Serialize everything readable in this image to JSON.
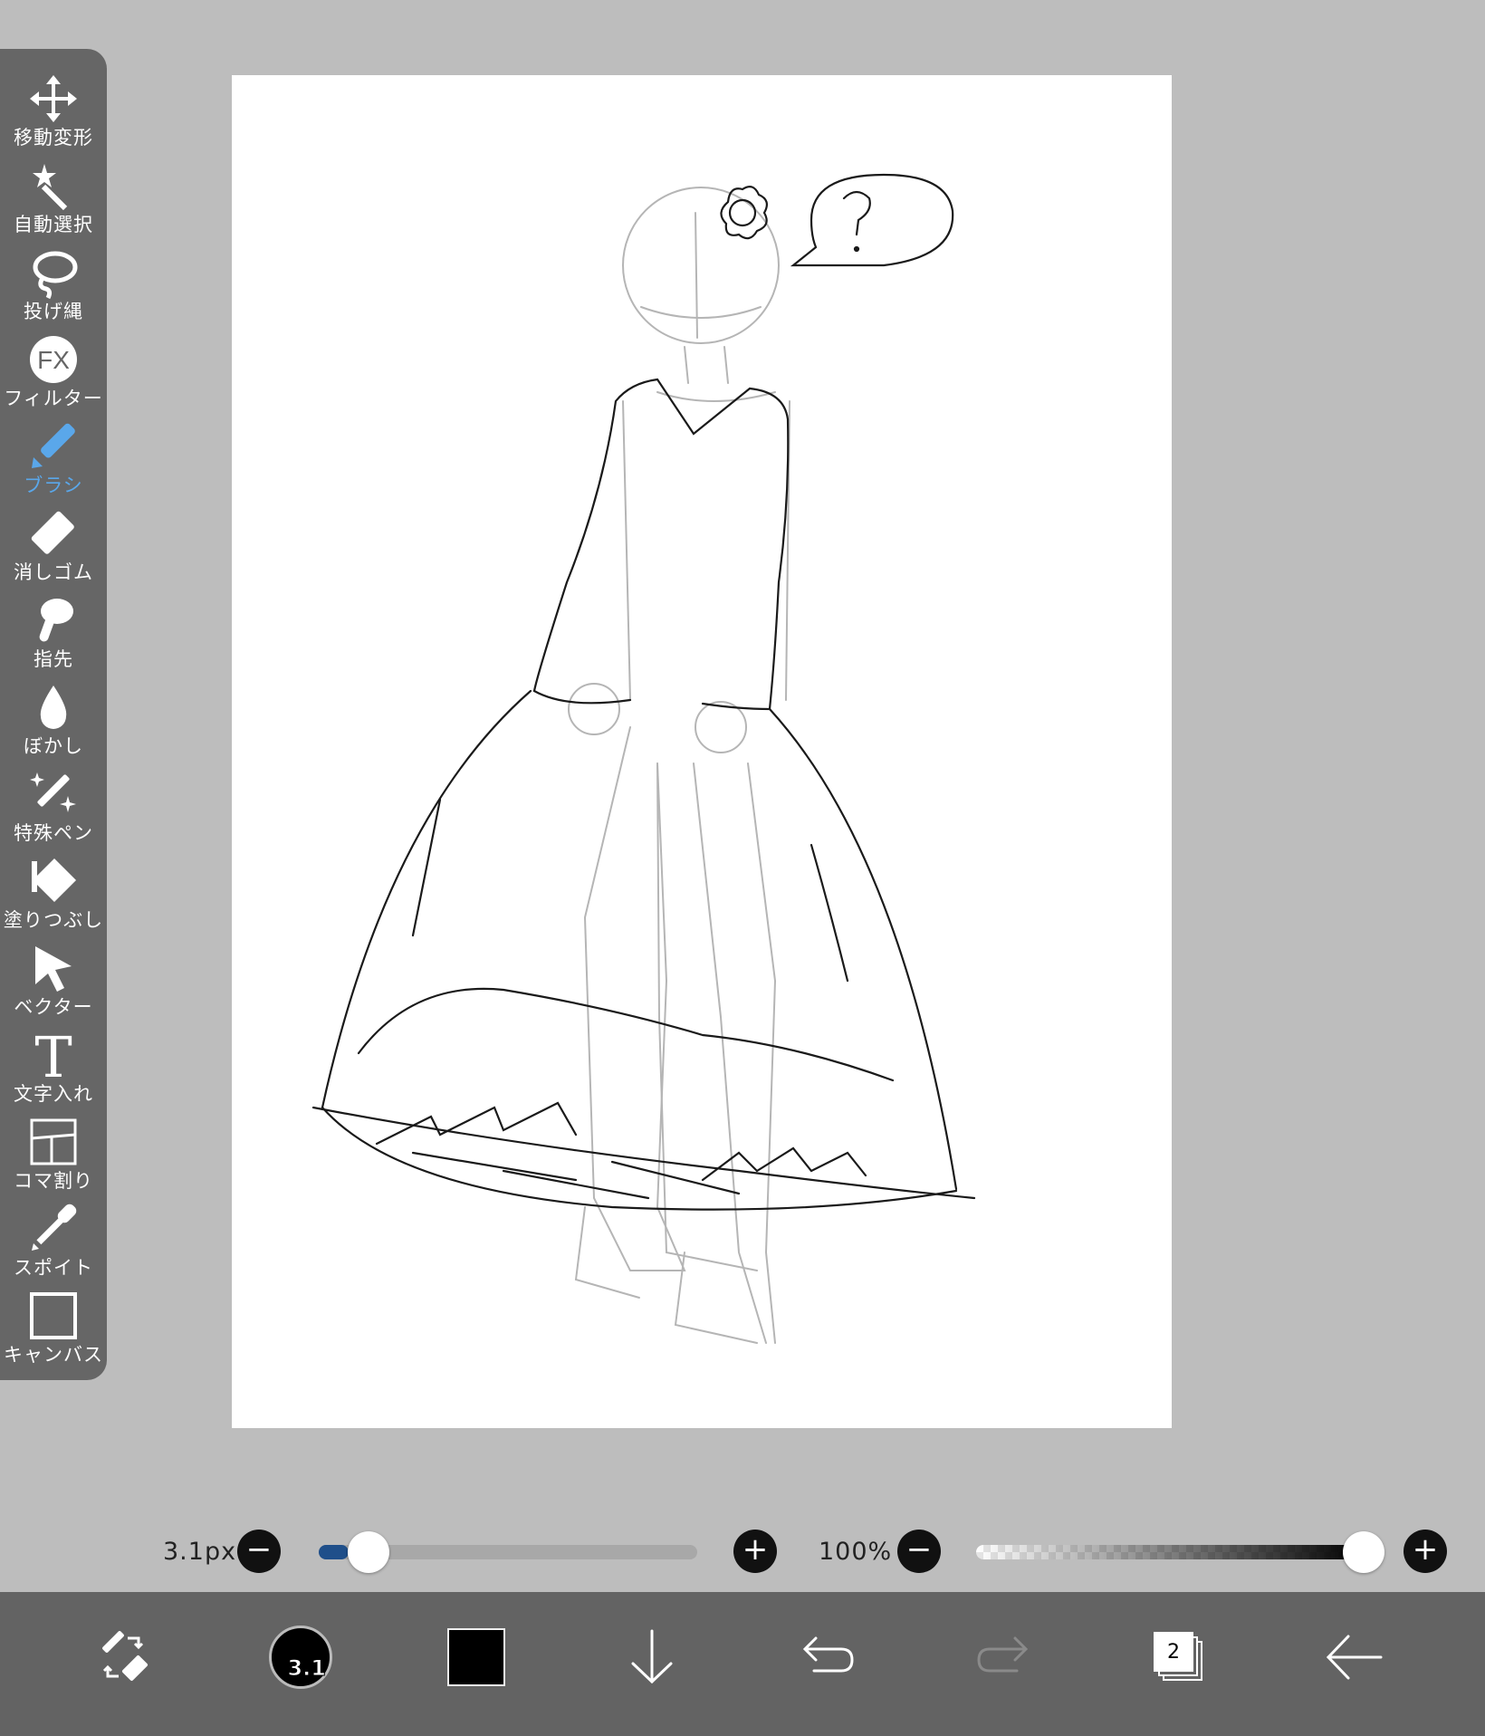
{
  "tools": [
    {
      "id": "move",
      "label": "移動変形",
      "icon": "move-arrows-icon"
    },
    {
      "id": "magic-wand",
      "label": "自動選択",
      "icon": "magic-wand-icon"
    },
    {
      "id": "lasso",
      "label": "投げ縄",
      "icon": "lasso-icon"
    },
    {
      "id": "filter",
      "label": "フィルター",
      "icon": "fx-icon",
      "icon_text": "FX"
    },
    {
      "id": "brush",
      "label": "ブラシ",
      "icon": "brush-icon",
      "active": true
    },
    {
      "id": "eraser",
      "label": "消しゴム",
      "icon": "eraser-icon"
    },
    {
      "id": "smudge",
      "label": "指先",
      "icon": "finger-icon"
    },
    {
      "id": "blur",
      "label": "ぼかし",
      "icon": "droplet-icon"
    },
    {
      "id": "special-pen",
      "label": "特殊ペン",
      "icon": "sparkle-pen-icon"
    },
    {
      "id": "fill",
      "label": "塗りつぶし",
      "icon": "fill-bucket-icon"
    },
    {
      "id": "vector",
      "label": "ベクター",
      "icon": "cursor-arrow-icon"
    },
    {
      "id": "text",
      "label": "文字入れ",
      "icon": "text-t-icon",
      "icon_text": "T"
    },
    {
      "id": "frame-divider",
      "label": "コマ割り",
      "icon": "frame-divider-icon"
    },
    {
      "id": "eyedropper",
      "label": "スポイト",
      "icon": "eyedropper-icon"
    },
    {
      "id": "canvas",
      "label": "キャンバス",
      "icon": "canvas-square-icon"
    }
  ],
  "brush_size": {
    "label": "3.1px",
    "value_fraction": 0.08,
    "minus": "−",
    "plus": "+"
  },
  "brush_opacity": {
    "label": "100%",
    "value_fraction": 1.0,
    "minus": "−",
    "plus": "+"
  },
  "bottom_bar": {
    "brush_preview_text": "3.1",
    "color": "#000000",
    "layer_count": "2"
  },
  "colors": {
    "accent": "#5aa7ea",
    "panel": "#666666",
    "background": "#bdbdbd"
  }
}
